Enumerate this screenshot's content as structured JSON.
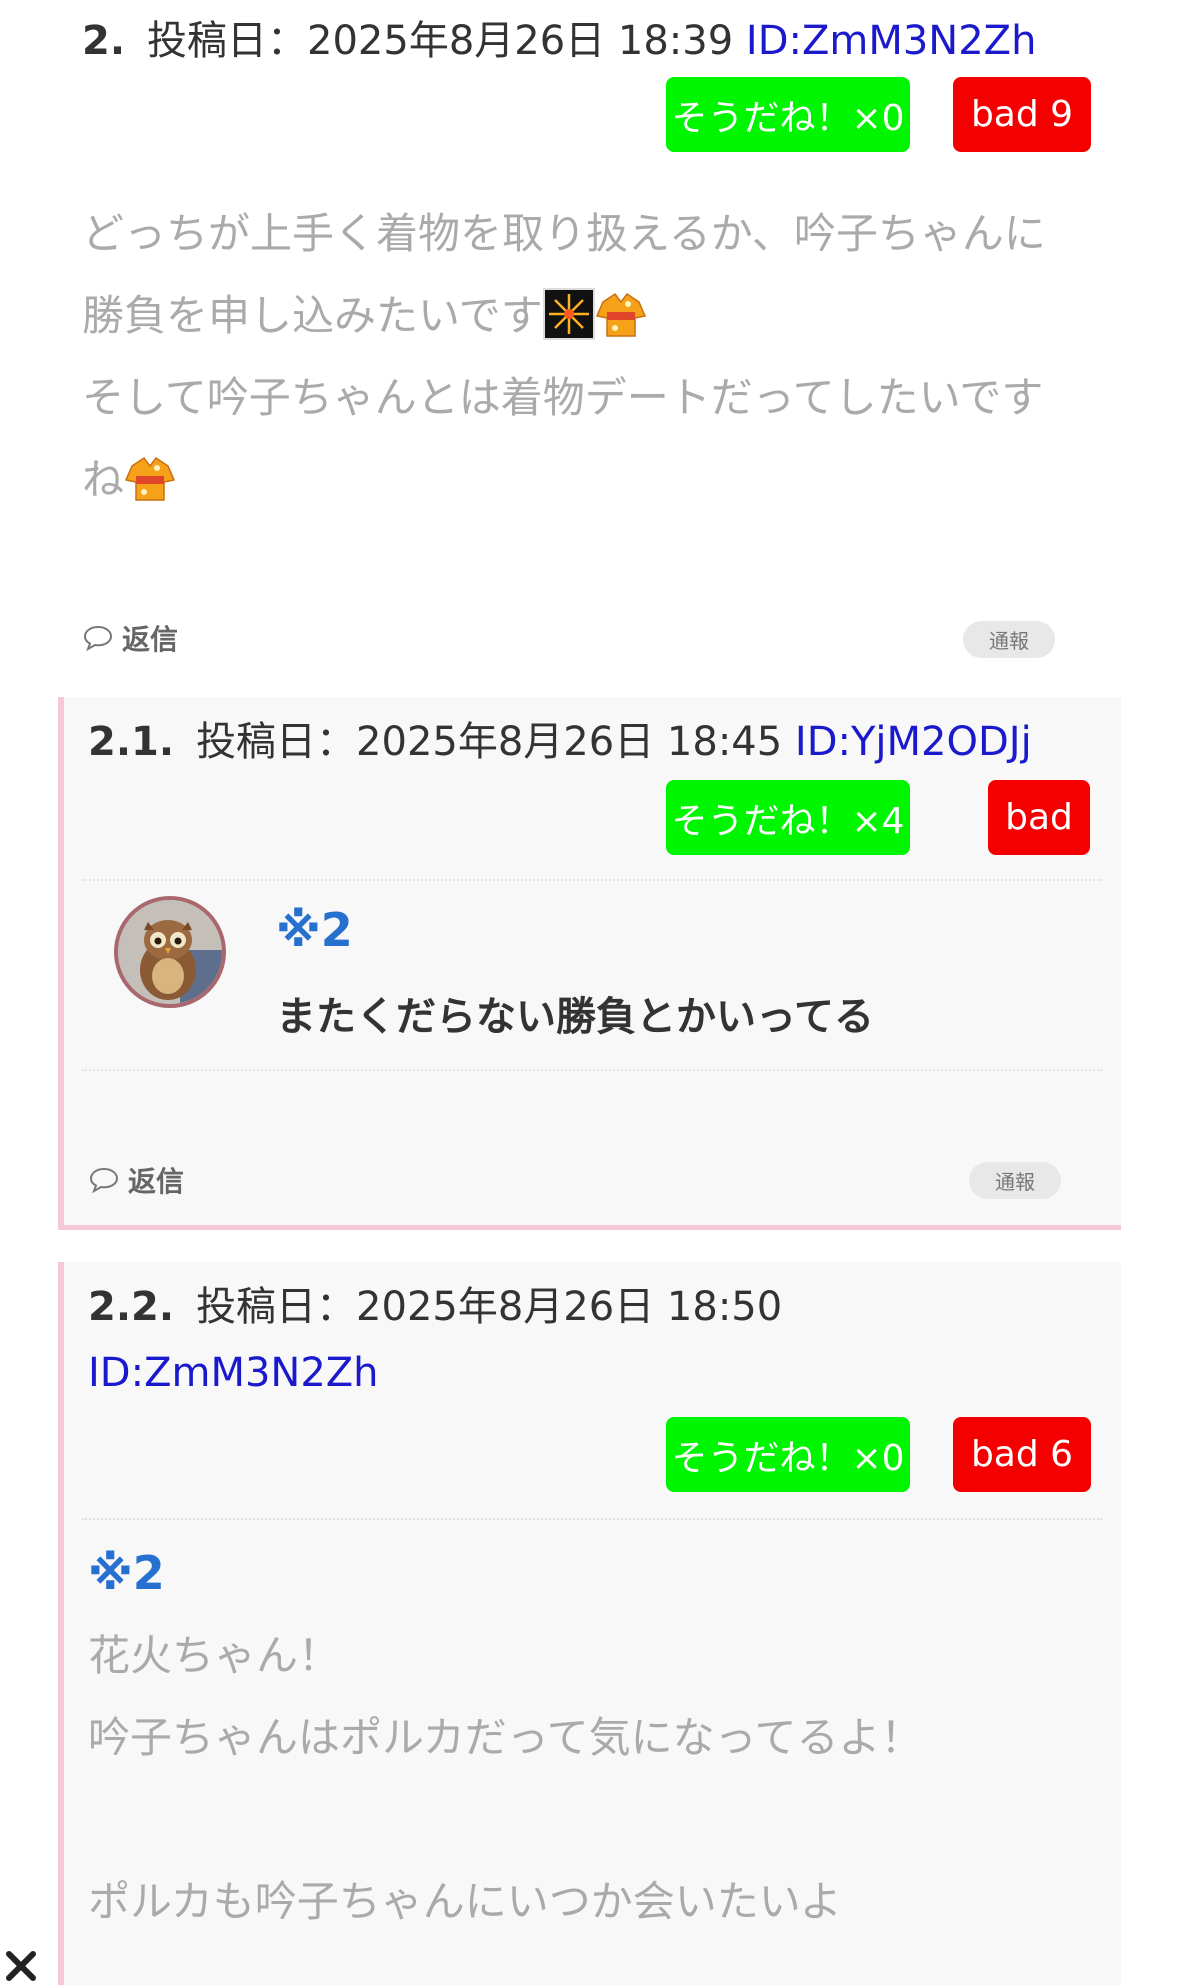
{
  "post2": {
    "number": "2.",
    "date": "投稿日：2025年8月26日 18:39",
    "id": "ID:ZmM3N2Zh",
    "good_label": "そうだね！×0",
    "bad_label": "bad 9",
    "lines": [
      "どっちが上手く着物を取り扱えるか、吟子ちゃんに",
      "勝負を申し込みたいです",
      "そして吟子ちゃんとは着物デートだってしたいです",
      "ね"
    ],
    "reply_label": "返信",
    "report_label": "通報"
  },
  "post21": {
    "number": "2.1.",
    "date": "投稿日：2025年8月26日 18:45",
    "id": "ID:YjM2ODJj",
    "good_label": "そうだね！×4",
    "bad_label": "bad",
    "quote_ref": "※2",
    "quote_text": "またくだらない勝負とかいってる",
    "reply_label": "返信",
    "report_label": "通報"
  },
  "post22": {
    "number": "2.2.",
    "date": "投稿日：2025年8月26日 18:50",
    "id": "ID:ZmM3N2Zh",
    "good_label": "そうだね！×0",
    "bad_label": "bad 6",
    "quote_ref": "※2",
    "lines": [
      "花火ちゃん！",
      "吟子ちゃんはポルカだって気になってるよ！",
      "",
      "ポルカも吟子ちゃんにいつか会いたいよ"
    ]
  },
  "icons": {
    "reply": "speech-bubble-icon",
    "close": "close-icon",
    "emoji1": "fireworks-emoji",
    "emoji2": "kimono-emoji"
  },
  "colors": {
    "good": "#00f500",
    "bad": "#f50000",
    "id_link": "#1a1acc",
    "quote": "#2670d0",
    "child_border": "#f7c8d8"
  }
}
